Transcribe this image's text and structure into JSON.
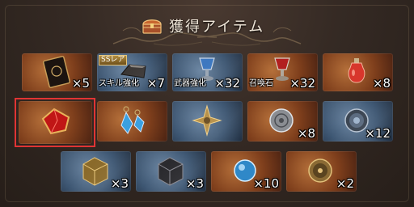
{
  "header": {
    "title": "獲得アイテム",
    "icon": "treasure-chest-icon"
  },
  "rows": [
    [
      {
        "kind": "bronze",
        "icon": "grimoire-icon",
        "quantity": "×5"
      },
      {
        "kind": "blue",
        "icon": "skill-stone-icon",
        "badge": "SSレア",
        "label": "スキル強化",
        "quantity": "×7"
      },
      {
        "kind": "blue",
        "icon": "weapon-chalice-icon",
        "label": "武器強化",
        "quantity": "×32"
      },
      {
        "kind": "bronze",
        "icon": "summon-chalice-icon",
        "label": "召喚石",
        "quantity": "×32"
      },
      {
        "kind": "bronze",
        "icon": "potion-bottle-icon",
        "quantity": "×8"
      }
    ],
    [
      {
        "kind": "bronze",
        "icon": "red-gem-icon",
        "quantity": "",
        "selected": true
      },
      {
        "kind": "bronze",
        "icon": "blue-earrings-icon",
        "quantity": ""
      },
      {
        "kind": "blue",
        "icon": "ornate-cross-icon",
        "quantity": ""
      },
      {
        "kind": "bronze",
        "icon": "silver-medal-icon",
        "quantity": "×8"
      },
      {
        "kind": "blue",
        "icon": "dark-medal-icon",
        "quantity": "×12"
      }
    ],
    [
      {
        "kind": "blue",
        "icon": "gold-cube-icon",
        "quantity": "×3"
      },
      {
        "kind": "blue",
        "icon": "dark-cube-icon",
        "quantity": "×3"
      },
      {
        "kind": "bronze",
        "icon": "blue-orb-icon",
        "quantity": "×10"
      },
      {
        "kind": "bronze",
        "icon": "gold-medal-icon",
        "quantity": "×2"
      }
    ]
  ],
  "colors": {
    "selection": "#e03434",
    "bronze": "#7f3f1c",
    "blue": "#3d5672",
    "title": "#efe6d8"
  }
}
